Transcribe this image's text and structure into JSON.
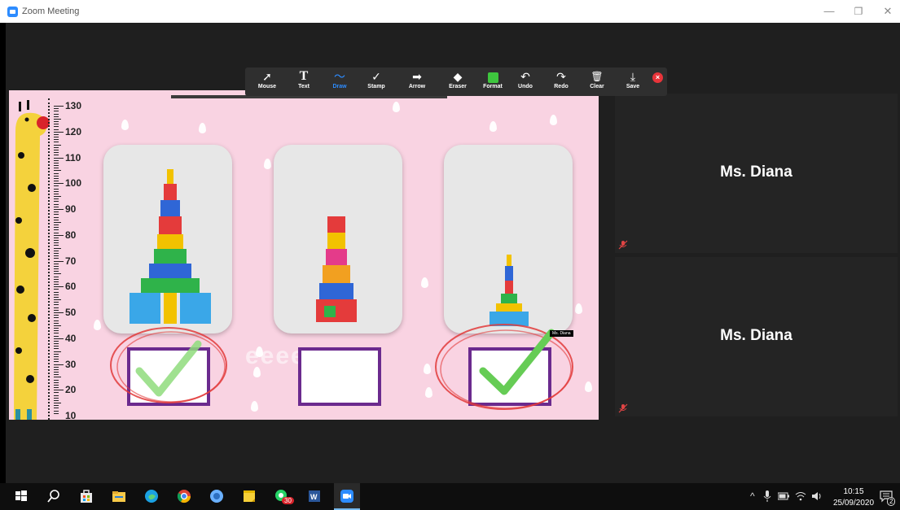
{
  "window": {
    "title": "Zoom Meeting",
    "minimize": "—",
    "restore": "❐",
    "close": "✕"
  },
  "toolbar": {
    "tools": [
      {
        "label": "Mouse",
        "icon": "mouse-pointer-icon",
        "glyph": "➚"
      },
      {
        "label": "Text",
        "icon": "text-icon",
        "glyph": "T"
      },
      {
        "label": "Draw",
        "icon": "draw-icon",
        "glyph": "〜",
        "active": true
      },
      {
        "label": "Stamp",
        "icon": "stamp-icon",
        "glyph": "✓"
      },
      {
        "label": "Arrow",
        "icon": "arrow-icon",
        "glyph": "➡"
      },
      {
        "label": "Eraser",
        "icon": "eraser-icon",
        "glyph": "◆"
      },
      {
        "label": "Format",
        "icon": "format-icon",
        "glyph": "■"
      },
      {
        "label": "Undo",
        "icon": "undo-icon",
        "glyph": "↶"
      },
      {
        "label": "Redo",
        "icon": "redo-icon",
        "glyph": "↷"
      },
      {
        "label": "Clear",
        "icon": "trash-icon",
        "glyph": "🗑"
      },
      {
        "label": "Save",
        "icon": "save-icon",
        "glyph": "⤓"
      }
    ],
    "active_color": "#2d8cff",
    "format_color": "#3ec63e",
    "close_color": "#e8343a"
  },
  "ruler": {
    "labels": [
      "130",
      "120",
      "110",
      "100",
      "90",
      "80",
      "70",
      "60",
      "50",
      "40",
      "30",
      "20",
      "10"
    ]
  },
  "annotation": {
    "tag": "Ms. Diana",
    "check_color": "#7fd96b",
    "circle_color": "#e23a3a"
  },
  "participants": [
    {
      "name": "Ms. Diana",
      "muted": true
    },
    {
      "name": "Ms. Diana",
      "muted": true
    }
  ],
  "taskbar": {
    "icons": [
      "windows-start-icon",
      "search-icon",
      "store-icon",
      "file-explorer-icon",
      "edge-icon",
      "chrome-icon",
      "skype-icon",
      "sticky-notes-icon",
      "whatsapp-icon",
      "word-icon",
      "zoom-icon"
    ],
    "whatsapp_badge": "30",
    "time": "10:15",
    "date": "25/09/2020",
    "notifications": "2"
  }
}
